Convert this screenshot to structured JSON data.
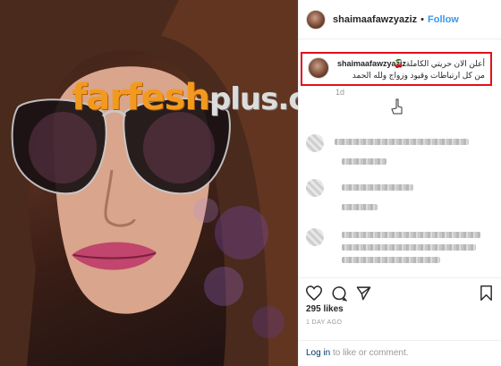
{
  "post": {
    "username": "shaimaafawzyaziz",
    "separator": "•",
    "follow_label": "Follow",
    "caption": {
      "username": "shaimaafawzyaziz",
      "line1": "أعلن الان حريتي الكاملة 🍒",
      "line2": "من كل ارتباطات وقيود وزواج ولله الحمد"
    },
    "caption_time": "1d",
    "likes": "295 likes",
    "timestamp": "1 DAY AGO"
  },
  "photo": {
    "watermark_main": "farfesh",
    "watermark_plus": "plus.com"
  },
  "footer": {
    "login_label": "Log in",
    "rest": " to like or comment."
  },
  "icons": [
    "heart-icon",
    "comment-icon",
    "share-icon",
    "bookmark-icon",
    "cursor-icon"
  ],
  "colors": {
    "follow": "#3897f0",
    "highlight_border": "#e0111b",
    "link": "#003569",
    "watermark": "#f29a1f"
  }
}
